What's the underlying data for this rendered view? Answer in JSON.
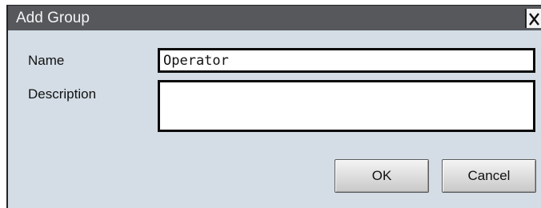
{
  "dialog": {
    "title": "Add Group",
    "close_glyph": "X",
    "close_icon": "close-icon"
  },
  "form": {
    "name_label": "Name",
    "name_value": "Operator",
    "description_label": "Description",
    "description_value": ""
  },
  "buttons": {
    "ok_label": "OK",
    "cancel_label": "Cancel"
  }
}
